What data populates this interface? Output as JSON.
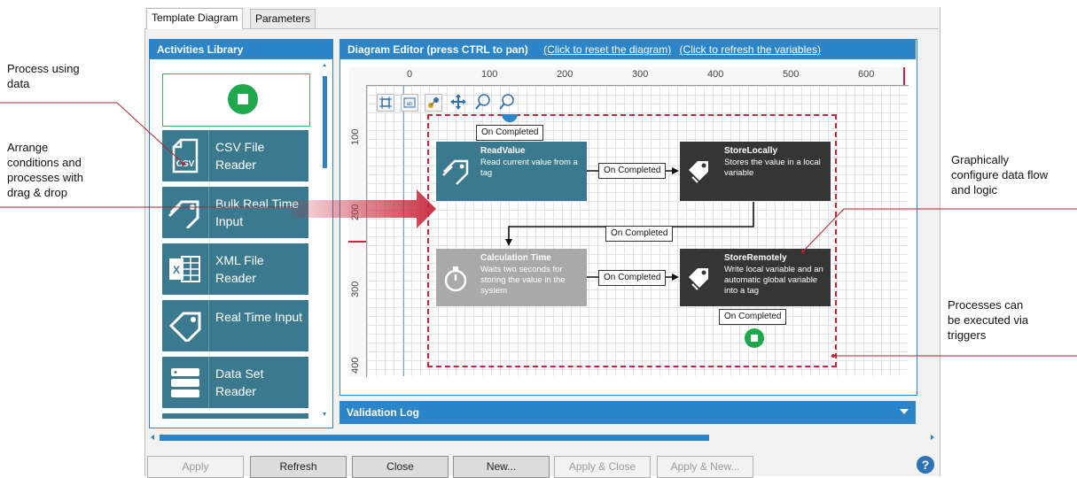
{
  "annotations": {
    "process_using_data": [
      "Process using",
      "data"
    ],
    "arrange": [
      "Arrange",
      "conditions and",
      "processes with",
      "drag & drop"
    ],
    "graphically": [
      "Graphically",
      "configure data flow",
      "and logic"
    ],
    "processes_triggers": [
      "Processes can",
      "be executed via",
      "triggers"
    ]
  },
  "tabs": [
    "Template Diagram",
    "Parameters"
  ],
  "library": {
    "title": "Activities Library",
    "items": [
      {
        "label": "CSV File Reader",
        "icon": "csv-file-icon"
      },
      {
        "label": "Bulk Real Time Input",
        "icon": "tag-multiple-icon"
      },
      {
        "label": "XML File Reader",
        "icon": "excel-icon"
      },
      {
        "label": "Real Time Input",
        "icon": "tag-icon"
      },
      {
        "label": "Data Set Reader",
        "icon": "database-icon"
      }
    ]
  },
  "editor": {
    "title": "Diagram Editor (press CTRL to pan)",
    "link_reset": "(Click to reset the diagram)",
    "link_refresh": "(Click to refresh the variables)",
    "ruler_top": [
      "0",
      "100",
      "200",
      "300",
      "400",
      "500",
      "600"
    ],
    "ruler_left": [
      "100",
      "200",
      "300",
      "400"
    ],
    "connector_label": "On Completed",
    "nodes": [
      {
        "title": "ReadValue",
        "desc": "Read current value from a tag",
        "color": "#3b7a8e"
      },
      {
        "title": "StoreLocally",
        "desc": "Stores the value in a local variable",
        "color": "#353535"
      },
      {
        "title": "Calculation Time",
        "desc": "Waits two seconds for storing the value in the system",
        "color": "#a9a9a9"
      },
      {
        "title": "StoreRemotely",
        "desc": "Write local variable and an automatic global variable into a tag",
        "color": "#353535"
      }
    ]
  },
  "validation_log": "Validation Log",
  "buttons": [
    {
      "label": "Apply",
      "enabled": false
    },
    {
      "label": "Refresh",
      "enabled": true
    },
    {
      "label": "Close",
      "enabled": true
    },
    {
      "label": "New...",
      "enabled": true
    },
    {
      "label": "Apply & Close",
      "enabled": false
    },
    {
      "label": "Apply & New...",
      "enabled": false
    }
  ],
  "help": "?",
  "colors": {
    "accent": "#2c84c9",
    "teal": "#3b7a8e",
    "dark": "#353535",
    "grey": "#a9a9a9",
    "annotation": "#c7273a",
    "green": "#1fa84b"
  }
}
